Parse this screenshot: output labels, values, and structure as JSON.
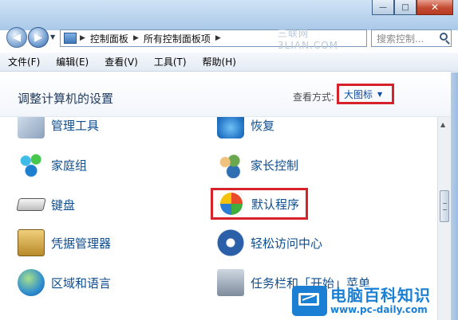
{
  "window": {
    "minimize": "—",
    "maximize": "□",
    "close": "✕"
  },
  "address_bar": {
    "breadcrumbs": [
      "控制面板",
      "所有控制面板项"
    ],
    "watermark": "三联网 3LIAN.COM",
    "refresh": "↻"
  },
  "search": {
    "placeholder": "搜索控制..."
  },
  "menu": [
    "文件(F)",
    "编辑(E)",
    "查看(V)",
    "工具(T)",
    "帮助(H)"
  ],
  "header": {
    "title": "调整计算机的设置",
    "view_label": "查看方式:",
    "view_value": "大图标"
  },
  "items": [
    {
      "label": "管理工具",
      "icon": "admin-tools-icon"
    },
    {
      "label": "恢复",
      "icon": "recovery-icon"
    },
    {
      "label": "家庭组",
      "icon": "homegroup-icon"
    },
    {
      "label": "家长控制",
      "icon": "parental-controls-icon"
    },
    {
      "label": "键盘",
      "icon": "keyboard-icon"
    },
    {
      "label": "默认程序",
      "icon": "default-programs-icon"
    },
    {
      "label": "凭据管理器",
      "icon": "credential-manager-icon"
    },
    {
      "label": "轻松访问中心",
      "icon": "ease-of-access-icon"
    },
    {
      "label": "区域和语言",
      "icon": "region-language-icon"
    },
    {
      "label": "任务栏和「开始」菜单",
      "icon": "taskbar-start-menu-icon"
    }
  ],
  "highlight_color": "#d6222b",
  "logo": {
    "name": "电脑百科知识",
    "url": "www.pc-daily.com"
  }
}
